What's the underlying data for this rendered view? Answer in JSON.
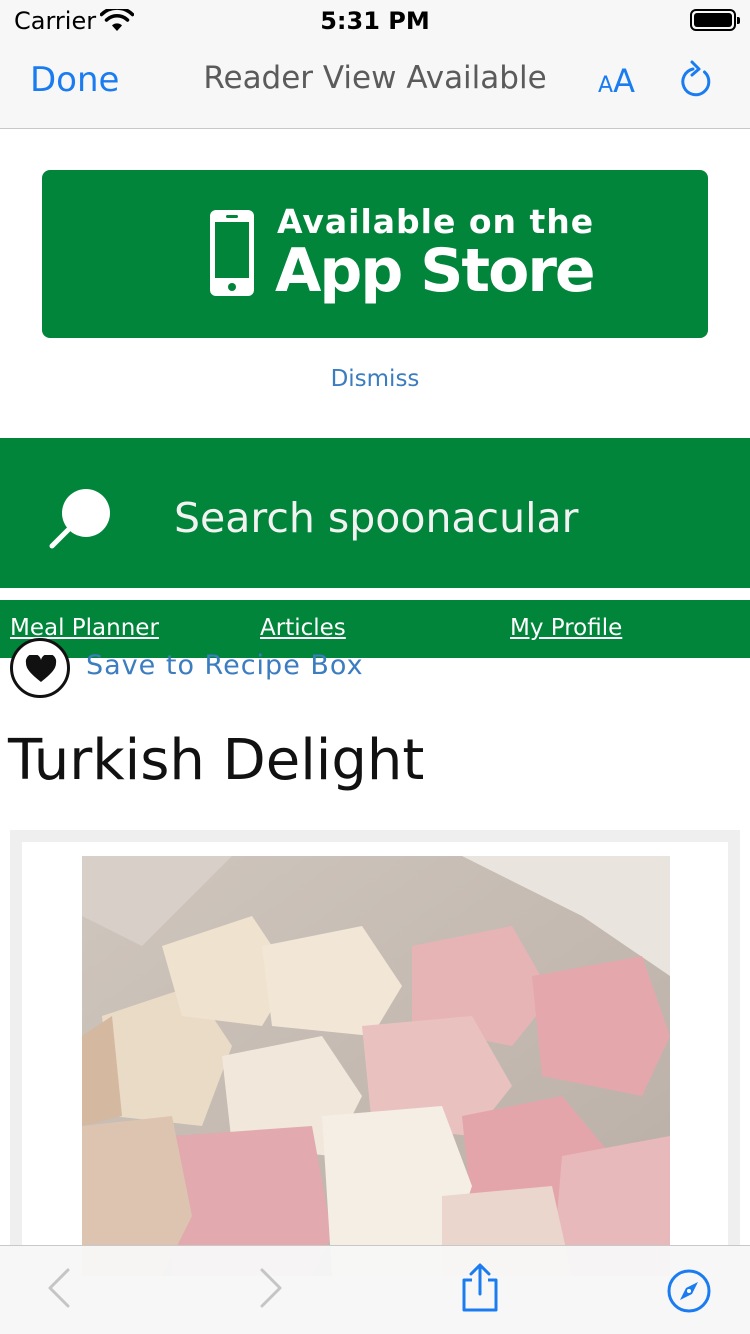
{
  "status_bar": {
    "carrier": "Carrier",
    "time": "5:31 PM"
  },
  "nav_bar": {
    "done_label": "Done",
    "title": "Reader View Available",
    "text_size_small": "A",
    "text_size_big": "A"
  },
  "app_store_banner": {
    "line1": "Available on the",
    "line2": "App Store",
    "dismiss_label": "Dismiss"
  },
  "search": {
    "placeholder": "Search spoonacular"
  },
  "menu": {
    "items": [
      {
        "label": "Meal Planner"
      },
      {
        "label": "Articles"
      },
      {
        "label": "My Profile"
      }
    ]
  },
  "recipe": {
    "save_label": "Save to Recipe Box",
    "title": "Turkish Delight"
  },
  "colors": {
    "brand_green": "#01853a",
    "ios_blue": "#1a7cf0",
    "link_blue": "#3b7dc0"
  },
  "icons": {
    "wifi": "wifi-icon",
    "battery": "battery-icon",
    "text_size": "text-size-icon",
    "reload": "reload-icon",
    "phone": "phone-icon",
    "search": "search-icon",
    "heart": "heart-icon",
    "back": "chevron-left-icon",
    "forward": "chevron-right-icon",
    "share": "share-icon",
    "compass": "compass-icon"
  }
}
